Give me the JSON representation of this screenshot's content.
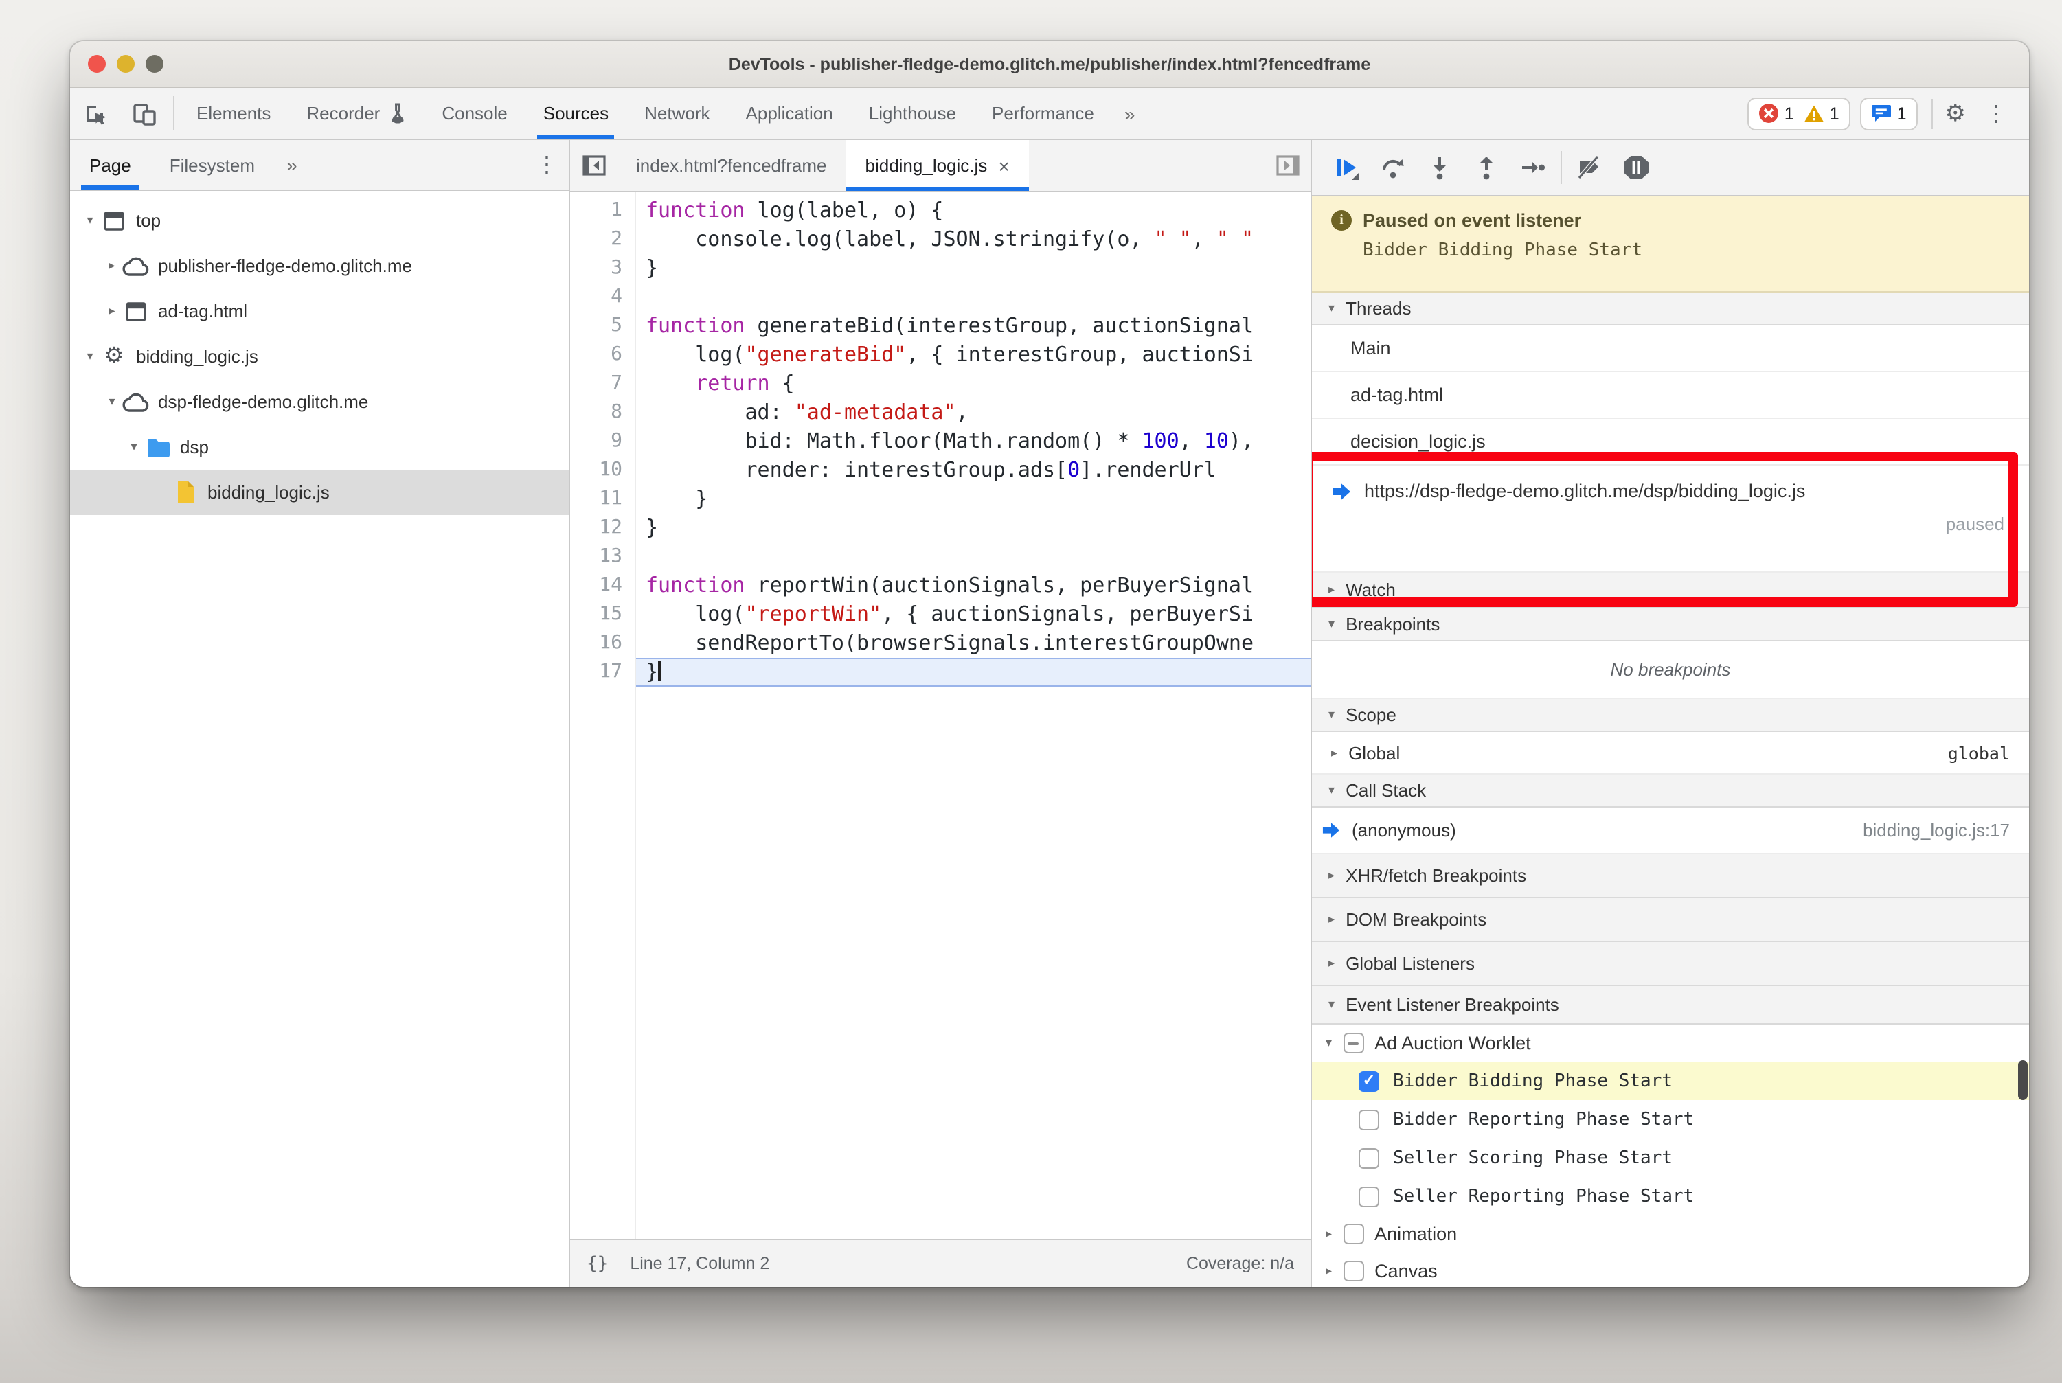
{
  "window": {
    "title": "DevTools - publisher-fledge-demo.glitch.me/publisher/index.html?fencedframe"
  },
  "icons": {
    "overflow": "»",
    "kebab": "⋮",
    "close_tab": "×",
    "braces": "{}",
    "arrow_down": "▾",
    "arrow_right": "▸",
    "gear": "⚙"
  },
  "toolbar": {
    "tabs": [
      {
        "label": "Elements",
        "active": false
      },
      {
        "label": "Recorder",
        "active": false,
        "icon": "flask-icon"
      },
      {
        "label": "Console",
        "active": false
      },
      {
        "label": "Sources",
        "active": true
      },
      {
        "label": "Network",
        "active": false
      },
      {
        "label": "Application",
        "active": false
      },
      {
        "label": "Lighthouse",
        "active": false
      },
      {
        "label": "Performance",
        "active": false
      }
    ],
    "badges": {
      "errors": "1",
      "warnings": "1",
      "messages": "1"
    }
  },
  "navigator": {
    "tabs": [
      {
        "label": "Page",
        "active": true
      },
      {
        "label": "Filesystem",
        "active": false
      }
    ],
    "tree": [
      {
        "label": "top",
        "icon": "frame-icon",
        "arrow": "down",
        "depth": 0
      },
      {
        "label": "publisher-fledge-demo.glitch.me",
        "icon": "cloud-icon",
        "arrow": "right",
        "depth": 1
      },
      {
        "label": "ad-tag.html",
        "icon": "frame-icon",
        "arrow": "right",
        "depth": 1
      },
      {
        "label": "bidding_logic.js",
        "icon": "worklet-icon",
        "arrow": "down",
        "depth": 0
      },
      {
        "label": "dsp-fledge-demo.glitch.me",
        "icon": "cloud-icon",
        "arrow": "down",
        "depth": 1
      },
      {
        "label": "dsp",
        "icon": "folder-icon",
        "arrow": "down",
        "depth": 2
      },
      {
        "label": "bidding_logic.js",
        "icon": "file-icon",
        "arrow": "none",
        "depth": 3,
        "selected": true
      }
    ]
  },
  "editor": {
    "tabs": [
      {
        "label": "index.html?fencedframe",
        "active": false
      },
      {
        "label": "bidding_logic.js",
        "active": true,
        "close": "×"
      }
    ],
    "lines": [
      {
        "n": "1",
        "seg": [
          [
            "k",
            "function"
          ],
          [
            "d",
            " log(label, o) {"
          ]
        ]
      },
      {
        "n": "2",
        "seg": [
          [
            "d",
            "    console.log(label, JSON.stringify(o, "
          ],
          [
            "s",
            "\" \""
          ],
          [
            "d",
            ", "
          ],
          [
            "s",
            "\" \""
          ]
        ]
      },
      {
        "n": "3",
        "seg": [
          [
            "d",
            "}"
          ]
        ]
      },
      {
        "n": "4",
        "seg": []
      },
      {
        "n": "5",
        "seg": [
          [
            "k",
            "function"
          ],
          [
            "d",
            " generateBid(interestGroup, auctionSignal"
          ]
        ]
      },
      {
        "n": "6",
        "seg": [
          [
            "d",
            "    log("
          ],
          [
            "s",
            "\"generateBid\""
          ],
          [
            "d",
            ", { interestGroup, auctionSi"
          ]
        ]
      },
      {
        "n": "7",
        "seg": [
          [
            "d",
            "    "
          ],
          [
            "k",
            "return"
          ],
          [
            "d",
            " {"
          ]
        ]
      },
      {
        "n": "8",
        "seg": [
          [
            "d",
            "        ad: "
          ],
          [
            "s",
            "\"ad-metadata\""
          ],
          [
            "d",
            ","
          ]
        ]
      },
      {
        "n": "9",
        "seg": [
          [
            "d",
            "        bid: Math.floor(Math.random() * "
          ],
          [
            "n2",
            "100"
          ],
          [
            "d",
            ", "
          ],
          [
            "n2",
            "10"
          ],
          [
            "d",
            "),"
          ]
        ]
      },
      {
        "n": "10",
        "seg": [
          [
            "d",
            "        render: interestGroup.ads["
          ],
          [
            "n2",
            "0"
          ],
          [
            "d",
            "].renderUrl"
          ]
        ]
      },
      {
        "n": "11",
        "seg": [
          [
            "d",
            "    }"
          ]
        ]
      },
      {
        "n": "12",
        "seg": [
          [
            "d",
            "}"
          ]
        ]
      },
      {
        "n": "13",
        "seg": []
      },
      {
        "n": "14",
        "seg": [
          [
            "k",
            "function"
          ],
          [
            "d",
            " reportWin(auctionSignals, perBuyerSignal"
          ]
        ]
      },
      {
        "n": "15",
        "seg": [
          [
            "d",
            "    log("
          ],
          [
            "s",
            "\"reportWin\""
          ],
          [
            "d",
            ", { auctionSignals, perBuyerSi"
          ]
        ]
      },
      {
        "n": "16",
        "seg": [
          [
            "d",
            "    sendReportTo(browserSignals.interestGroupOwne"
          ]
        ]
      },
      {
        "n": "17",
        "seg": [
          [
            "d",
            "}"
          ]
        ],
        "hl": true
      }
    ],
    "status": {
      "left": "Line 17, Column 2",
      "right": "Coverage: n/a"
    }
  },
  "debugger": {
    "paused_banner": {
      "title": "Paused on event listener",
      "subtitle": "Bidder Bidding Phase Start"
    },
    "threads": {
      "header": "Threads",
      "items": [
        "Main",
        "ad-tag.html",
        "decision_logic.js"
      ],
      "current": {
        "url": "https://dsp-fledge-demo.glitch.me/dsp/bidding_logic.js",
        "status": "paused"
      }
    },
    "watch": {
      "header": "Watch"
    },
    "breakpoints": {
      "header": "Breakpoints",
      "empty": "No breakpoints"
    },
    "scope": {
      "header": "Scope",
      "rows": [
        {
          "label": "Global",
          "value": "global"
        }
      ]
    },
    "call_stack": {
      "header": "Call Stack",
      "rows": [
        {
          "label": "(anonymous)",
          "location": "bidding_logic.js:17"
        }
      ]
    },
    "collapsed_sections": [
      "XHR/fetch Breakpoints",
      "DOM Breakpoints",
      "Global Listeners"
    ],
    "event_listener_breakpoints": {
      "header": "Event Listener Breakpoints",
      "category": {
        "label": "Ad Auction Worklet",
        "state": "indeterminate"
      },
      "items": [
        {
          "label": "Bidder Bidding Phase Start",
          "checked": true,
          "highlighted": true
        },
        {
          "label": "Bidder Reporting Phase Start",
          "checked": false
        },
        {
          "label": "Seller Scoring Phase Start",
          "checked": false
        },
        {
          "label": "Seller Reporting Phase Start",
          "checked": false
        }
      ],
      "more_categories": [
        {
          "label": "Animation"
        },
        {
          "label": "Canvas"
        }
      ]
    }
  },
  "colors": {
    "accent": "#1a73e8",
    "paused_banner_bg": "#fbf3d1",
    "elbp_highlight": "#fbfacf",
    "annotation_red": "#f80312",
    "exec_line_bg": "#e7effc",
    "error_red": "#e0443a",
    "warning_yellow": "#e0a100",
    "message_blue": "#1a73e8"
  }
}
